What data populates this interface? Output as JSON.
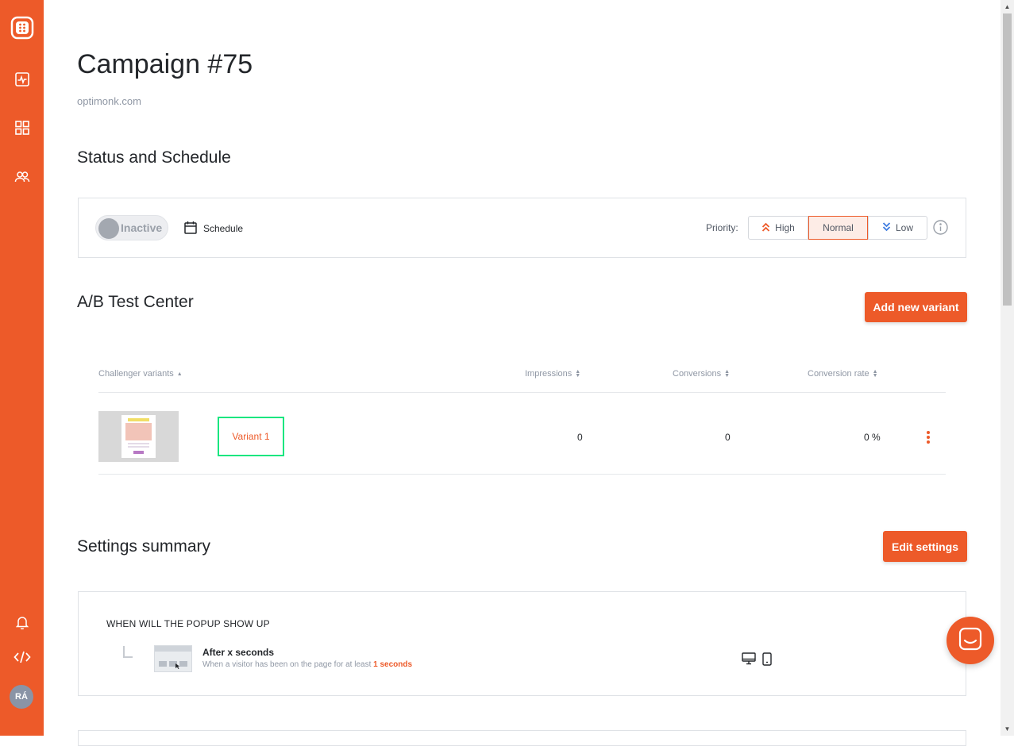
{
  "sidebar": {
    "avatar_initials": "RÁ",
    "icons": [
      "logo-icon",
      "analytics-icon",
      "campaigns-grid-icon",
      "users-icon",
      "bell-icon",
      "code-icon"
    ]
  },
  "page": {
    "title": "Campaign #75",
    "domain": "optimonk.com"
  },
  "status_schedule": {
    "heading": "Status and Schedule",
    "toggle_label": "Inactive",
    "schedule_label": "Schedule",
    "priority_label": "Priority:",
    "priority_options": [
      "High",
      "Normal",
      "Low"
    ],
    "priority_selected": "Normal"
  },
  "ab_test": {
    "heading": "A/B Test Center",
    "add_variant_label": "Add new variant",
    "columns": [
      "Challenger variants",
      "Impressions",
      "Conversions",
      "Conversion rate"
    ],
    "rows": [
      {
        "name": "Variant 1",
        "impressions": "0",
        "conversions": "0",
        "conversion_rate": "0 %"
      }
    ]
  },
  "settings_summary": {
    "heading": "Settings summary",
    "edit_label": "Edit settings",
    "when_title": "WHEN WILL THE POPUP SHOW UP",
    "trigger_title": "After x seconds",
    "trigger_desc_prefix": "When a visitor has been on the page for at least",
    "trigger_desc_value": "1 seconds"
  },
  "colors": {
    "brand": "#ed5a29",
    "highlight": "#19e680"
  }
}
